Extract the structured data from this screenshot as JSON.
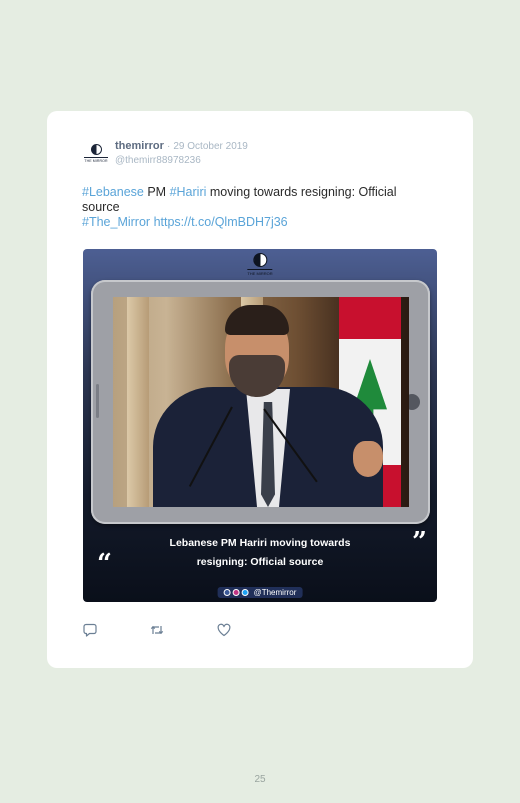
{
  "tweet": {
    "avatar_text": "THE MIRROR",
    "user_name": "themirror",
    "separator": "·",
    "date": "29 October 2019",
    "handle": "@themirr88978236",
    "text_parts": {
      "hashtag1": "#Lebanese",
      "t1": " PM ",
      "hashtag2": "#Hariri",
      "t2": " moving towards resigning: Official source",
      "hashtag3": "#The_Mirror",
      "t3": " ",
      "url": "https://t.co/QlmBDH7j36"
    }
  },
  "media": {
    "logo_text": "THE MIRROR",
    "caption_line1": "Lebanese PM Hariri moving towards",
    "caption_line2": "resigning: Official source",
    "quote_open": "“",
    "quote_close": "”",
    "social_handle": "@Themirror"
  },
  "actions": {
    "reply_icon": "reply-icon",
    "retweet_icon": "retweet-icon",
    "like_icon": "heart-icon"
  },
  "page_number": "25",
  "colors": {
    "background": "#e5ede2",
    "card": "#ffffff",
    "link": "#5aa4d8",
    "user_name": "#5d6b80",
    "muted": "#a9b7c4"
  }
}
